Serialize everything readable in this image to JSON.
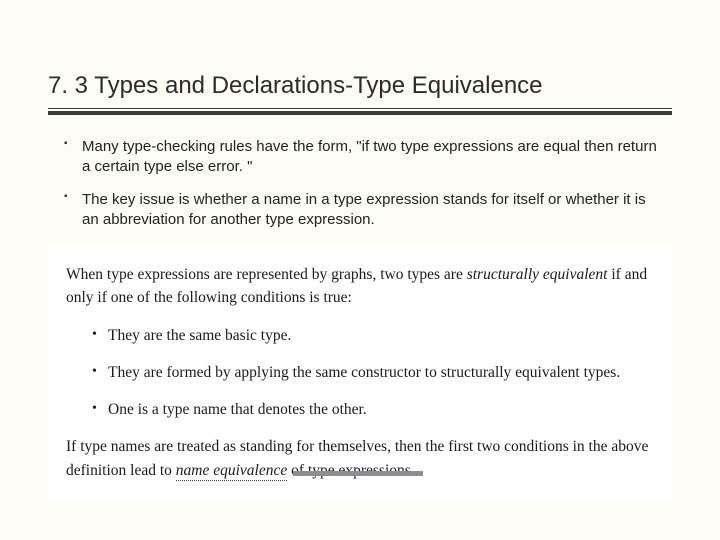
{
  "title": "7. 3 Types and Declarations-Type Equivalence",
  "bullets": [
    "Many type-checking rules have the form, \"if two type expressions are equal then return a certain type else error. \"",
    "The key issue is whether a name in a type expression stands for itself or whether it is an abbreviation for another type expression."
  ],
  "textbook": {
    "intro_pre": "When type expressions are represented by graphs, two types are ",
    "intro_em": "structurally equivalent",
    "intro_post": " if and only if one of the following conditions is true:",
    "items": [
      "They are the same basic type.",
      "They are formed by applying the same constructor to structurally equivalent types.",
      "One is a type name that denotes the other."
    ],
    "closing_pre": "If type names are treated as standing for themselves, then the first two conditions in the above definition lead to ",
    "closing_em": "name equivalence",
    "closing_post": " of type expressions."
  }
}
